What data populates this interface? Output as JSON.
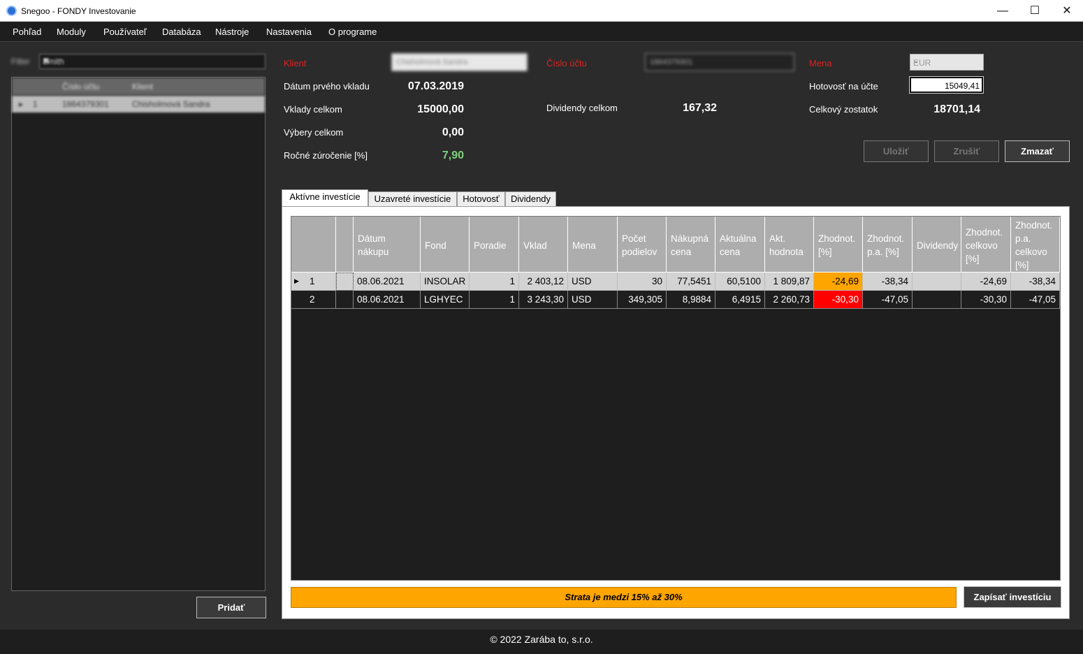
{
  "window": {
    "title": "Snegoo - FONDY Investovanie"
  },
  "menu": [
    "Pohľad",
    "Moduly",
    "Používateľ",
    "Databáza",
    "Nástroje",
    "Nastavenia",
    "O programe"
  ],
  "left_panel": {
    "filter_label": "Filter",
    "filter_value": "Smith",
    "list_headers": [
      "Číslo účtu",
      "Klient"
    ],
    "list_row": {
      "index": "1",
      "account": "1864379301",
      "client": "Chisholmová Sandra"
    },
    "add_button": "Pridať"
  },
  "info": {
    "client_label": "Klient",
    "client_value": "Chisholmová Sandra",
    "account_label": "Číslo účtu",
    "account_value": "1864379301",
    "currency_label": "Mena",
    "currency_value": "EUR",
    "first_deposit_label": "Dátum prvého vkladu",
    "first_deposit_value": "07.03.2019",
    "deposits_label": "Vklady celkom",
    "deposits_value": "15000,00",
    "withdrawals_label": "Výbery celkom",
    "withdrawals_value": "0,00",
    "annual_label": "Ročné zúročenie [%]",
    "annual_value": "7,90",
    "dividends_label": "Dividendy celkom",
    "dividends_value": "167,32",
    "cash_label": "Hotovosť na účte",
    "cash_value": "15049,41",
    "balance_label": "Celkový zostatok",
    "balance_value": "18701,14"
  },
  "buttons": {
    "save": "Uložiť",
    "cancel": "Zrušiť",
    "delete": "Zmazať",
    "record": "Zapísať investíciu"
  },
  "tabs": [
    "Aktívne investície",
    "Uzavreté investície",
    "Hotovosť",
    "Dividendy"
  ],
  "table": {
    "headers": [
      "",
      "",
      "Dátum nákupu",
      "Fond",
      "Poradie",
      "Vklad",
      "Mena",
      "Počet podielov",
      "Nákupná cena",
      "Aktuálna cena",
      "Akt. hodnota",
      "Zhodnot. [%]",
      "Zhodnot. p.a. [%]",
      "Dividendy",
      "Zhodnot. celkovo [%]",
      "Zhodnot. p.a. celkovo [%]"
    ],
    "rows": [
      [
        "1",
        "",
        "08.06.2021",
        "INSOLAR",
        "1",
        "2 403,12",
        "USD",
        "30",
        "77,5451",
        "60,5100",
        "1 809,87",
        "-24,69",
        "-38,34",
        "",
        "-24,69",
        "-38,34"
      ],
      [
        "2",
        "",
        "08.06.2021",
        "LGHYEC",
        "1",
        "3 243,30",
        "USD",
        "349,305",
        "8,9884",
        "6,4915",
        "2 260,73",
        "-30,30",
        "-47,05",
        "",
        "-30,30",
        "-47,05"
      ]
    ]
  },
  "status_message": "Strata je medzi 15% až 30%",
  "footer": "© 2022 Zarába to, s.r.o.",
  "colors": {
    "warning": "#ffa500",
    "loss": "#ff0000",
    "positive": "#7ed37e",
    "required_label": "#e02020"
  }
}
